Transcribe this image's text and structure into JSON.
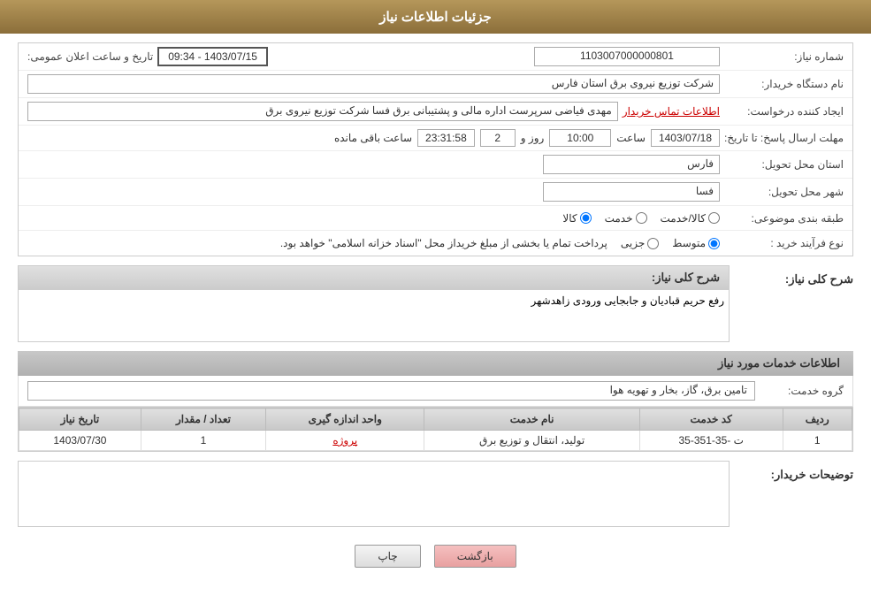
{
  "header": {
    "title": "جزئیات اطلاعات نیاز"
  },
  "form": {
    "shmare_niyaz_label": "شماره نیاز:",
    "shmare_niyaz_value": "1103007000000801",
    "announcement_label": "تاریخ و ساعت اعلان عمومی:",
    "announcement_value": "1403/07/15 - 09:34",
    "name_khardar_label": "نام دستگاه خریدار:",
    "name_khardar_value": "شرکت توزیع نیروی برق استان فارس",
    "ejad_label": "ایجاد کننده درخواست:",
    "ejad_value": "مهدی فیاضی سرپرست اداره مالی و پشتیبانی برق فسا شرکت توزیع نیروی برق",
    "ejad_link": "اطلاعات تماس خریدار",
    "mohlat_label": "مهلت ارسال پاسخ: تا تاریخ:",
    "mohlat_date": "1403/07/18",
    "mohlat_saat_label": "ساعت",
    "mohlat_saat": "10:00",
    "mohlat_rooz_label": "روز و",
    "mohlat_rooz": "2",
    "mohlat_baqi_label": "ساعت باقی مانده",
    "mohlat_baqi": "23:31:58",
    "ostan_label": "استان محل تحویل:",
    "ostan_value": "فارس",
    "shahr_label": "شهر محل تحویل:",
    "shahr_value": "فسا",
    "tabaqe_label": "طبقه بندی موضوعی:",
    "tabaqe_options": [
      "کالا",
      "خدمت",
      "کالا/خدمت"
    ],
    "tabaqe_selected": "کالا",
    "nogh_label": "نوع فرآیند خرید :",
    "nogh_options": [
      "جزیی",
      "متوسط"
    ],
    "nogh_selected": "متوسط",
    "nogh_note": "پرداخت تمام یا بخشی از مبلغ خریداز محل \"اسناد خزانه اسلامی\" خواهد بود.",
    "sharh_label": "شرح کلی نیاز:",
    "sharh_value": "رفع حریم قبادیان و جابجایی ورودی زاهدشهر",
    "khadamat_header": "اطلاعات خدمات مورد نیاز",
    "goroh_label": "گروه خدمت:",
    "goroh_value": "تامین برق، گاز، بخار و تهویه هوا",
    "table_headers": [
      "ردیف",
      "کد خدمت",
      "نام خدمت",
      "واحد اندازه گیری",
      "تعداد / مقدار",
      "تاریخ نیاز"
    ],
    "table_rows": [
      {
        "radif": "1",
        "code": "ت -35-351-35",
        "name": "تولید، انتقال و توزیع برق",
        "unit": "پروژه",
        "qty": "1",
        "date": "1403/07/30"
      }
    ],
    "tawzih_label": "توضیحات خریدار:",
    "tawzih_value": "",
    "btn_print": "چاپ",
    "btn_back": "بازگشت"
  }
}
